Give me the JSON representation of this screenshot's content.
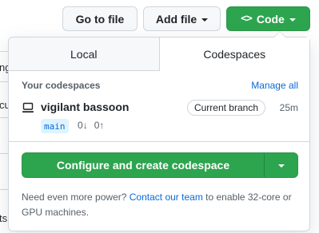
{
  "toolbar": {
    "goto_file_label": "Go to file",
    "add_file_label": "Add file",
    "code_label": "Code",
    "code_icon": "<>"
  },
  "background": {
    "fragments": [
      "ng",
      "cu",
      "er",
      "er",
      "ts"
    ]
  },
  "panel": {
    "tabs": [
      {
        "label": "Local",
        "selected": false
      },
      {
        "label": "Codespaces",
        "selected": true
      }
    ],
    "section_title": "Your codespaces",
    "manage_link": "Manage all",
    "codespace": {
      "name": "vigilant bassoon",
      "branch_badge": "Current branch",
      "age": "25m",
      "branch": "main",
      "behind": "0",
      "ahead": "0",
      "icon": "codespace-laptop-icon"
    },
    "create_button_label": "Configure and create codespace",
    "footer": {
      "prefix": "Need even more power?",
      "link": "Contact our team",
      "suffix": "to enable 32-core or GPU machines."
    }
  },
  "colors": {
    "primary_green": "#2da44e",
    "link_blue": "#0969da",
    "border": "#d0d7de",
    "muted_text": "#57606a"
  }
}
